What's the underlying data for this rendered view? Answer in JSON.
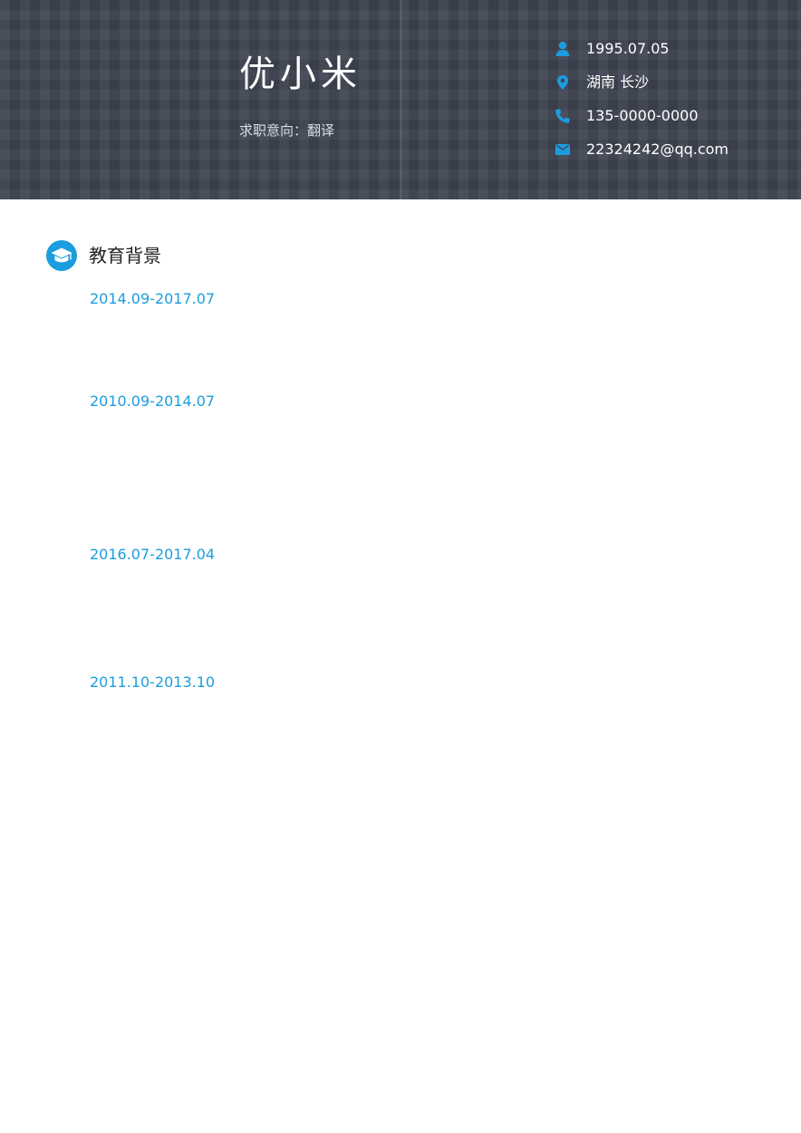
{
  "header": {
    "name": "优小米",
    "objective": "求职意向：翻译"
  },
  "contact": {
    "birthday": {
      "icon": "person-icon",
      "value": "1995.07.05"
    },
    "location": {
      "icon": "location-pin-icon",
      "value": "湖南 长沙"
    },
    "phone": {
      "icon": "phone-icon",
      "value": "135-0000-0000"
    },
    "email": {
      "icon": "email-icon",
      "value": "22324242@qq.com"
    }
  },
  "education": {
    "icon": "graduation-cap-icon",
    "title": "教育背景",
    "entries": [
      {
        "date": "2014.09-2017.07"
      },
      {
        "date": "2010.09-2014.07"
      },
      {
        "date": "2016.07-2017.04"
      },
      {
        "date": "2011.10-2013.10"
      }
    ]
  },
  "colors": {
    "header_background": "#3f4552",
    "accent": "#1c9ddf",
    "heading_text": "#222222",
    "header_text": "#ffffff"
  }
}
